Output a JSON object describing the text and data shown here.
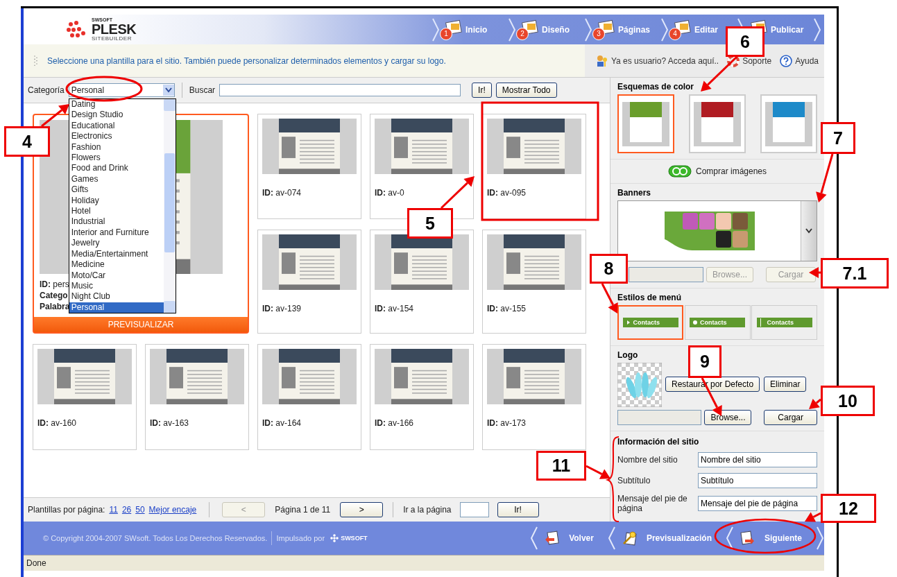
{
  "header": {
    "logo": {
      "maker": "SWSOFT",
      "brand": "PLESK",
      "product": "SITEBUILDER"
    },
    "steps": [
      {
        "number": "1",
        "label": "Inicio"
      },
      {
        "number": "2",
        "label": "Diseño"
      },
      {
        "number": "3",
        "label": "Páginas"
      },
      {
        "number": "4",
        "label": "Editar"
      },
      {
        "label": "Publicar"
      }
    ]
  },
  "info_bar": {
    "message": "Seleccione una plantilla para el sitio. También puede personalizar determinados elementos y cargar su logo.",
    "links": [
      {
        "label": "Ya es usuario? Acceda aquí..",
        "kind": "user"
      },
      {
        "label": "Soporte",
        "kind": "support"
      },
      {
        "label": "Ayuda",
        "kind": "help"
      }
    ]
  },
  "toolbar": {
    "category_label": "Categoría",
    "category_value": "Personal",
    "search_label": "Buscar",
    "buttons": [
      "Ir!",
      "Mostrar Todo"
    ]
  },
  "category_dropdown": {
    "expanded": true,
    "options": [
      {
        "label": "Dating",
        "selected": false
      },
      {
        "label": "Design Studio",
        "selected": false
      },
      {
        "label": "Educational",
        "selected": false
      },
      {
        "label": "Electronics",
        "selected": false
      },
      {
        "label": "Fashion",
        "selected": false
      },
      {
        "label": "Flowers",
        "selected": false
      },
      {
        "label": "Food and Drink",
        "selected": false
      },
      {
        "label": "Games",
        "selected": false
      },
      {
        "label": "Gifts",
        "selected": false
      },
      {
        "label": "Holiday",
        "selected": false
      },
      {
        "label": "Hotel",
        "selected": false
      },
      {
        "label": "Industrial",
        "selected": false
      },
      {
        "label": "Interior and Furniture",
        "selected": false
      },
      {
        "label": "Jewelry",
        "selected": false
      },
      {
        "label": "Media/Entertainment",
        "selected": false
      },
      {
        "label": "Medicine",
        "selected": false
      },
      {
        "label": "Moto/Car",
        "selected": false
      },
      {
        "label": "Music",
        "selected": false
      },
      {
        "label": "Night Club",
        "selected": false
      },
      {
        "label": "Personal",
        "selected": true
      }
    ]
  },
  "templates": [
    {
      "id_label": "ID:",
      "id": "pers",
      "selected": true,
      "details": [
        "Catego",
        "Palabra"
      ],
      "action": "PREVISUALIZAR"
    },
    {
      "id_label": "ID:",
      "id": "av-074",
      "selected": false
    },
    {
      "id_label": "ID:",
      "id": "av-0",
      "selected": false
    },
    {
      "id_label": "ID:",
      "id": "av-095",
      "selected": false
    },
    {
      "id_label": "ID:",
      "id": "av-139",
      "selected": false
    },
    {
      "id_label": "ID:",
      "id": "av-154",
      "selected": false
    },
    {
      "id_label": "ID:",
      "id": "av-155",
      "selected": false
    },
    {
      "id_label": "ID:",
      "id": "av-160",
      "selected": false
    },
    {
      "id_label": "ID:",
      "id": "av-163",
      "selected": false
    },
    {
      "id_label": "ID:",
      "id": "av-164",
      "selected": false
    },
    {
      "id_label": "ID:",
      "id": "av-166",
      "selected": false
    },
    {
      "id_label": "ID:",
      "id": "av-173",
      "selected": false
    }
  ],
  "pagination": {
    "per_page_label": "Plantillas por página:",
    "per_page_links": [
      "11",
      "26",
      "50",
      "Mejor encaje"
    ],
    "prev": {
      "label": "<",
      "disabled": true
    },
    "page_text": "Página 1 de 11",
    "next": {
      "label": ">",
      "disabled": false
    },
    "goto_label": "Ir a la página",
    "goto_button": "Ir!"
  },
  "side_panel": {
    "color_schemes": {
      "title": "Esquemas de color",
      "items": [
        {
          "selected": true,
          "color": "#6a9e2c"
        },
        {
          "selected": false,
          "color": "#b01c22"
        },
        {
          "selected": false,
          "color": "#1d8ac9"
        }
      ]
    },
    "buy_images": "Comprar imágenes",
    "banners": {
      "title": "Banners",
      "browse": {
        "label": "Browse...",
        "disabled": true
      },
      "upload": {
        "label": "Cargar",
        "disabled": true
      }
    },
    "menu_styles": {
      "title": "Estilos de menú",
      "items": [
        {
          "label": "Contacts",
          "kind": "arrow",
          "selected": true
        },
        {
          "label": "Contacts",
          "kind": "dot",
          "selected": false
        },
        {
          "label": "Contacts",
          "kind": "bar",
          "selected": false
        }
      ]
    },
    "logo": {
      "title": "Logo",
      "buttons": [
        "Restaurar por Defecto",
        "Eliminar"
      ],
      "browse": {
        "label": "Browse...",
        "disabled": false
      },
      "upload": {
        "label": "Cargar",
        "disabled": false
      }
    },
    "site_info": {
      "title": "Información del sitio",
      "fields": [
        {
          "label": "Nombre del sitio",
          "value": "Nombre del sitio"
        },
        {
          "label": "Subtítulo",
          "value": "Subtítulo"
        },
        {
          "label": "Mensaje del pie de página",
          "value": "Mensaje del pie de página"
        }
      ]
    }
  },
  "footer": {
    "copyright": "© Copyright 2004-2007 SWsoft. Todos Los Derechos Reservados.",
    "powered_by": "Impulsado por",
    "powered_logo": "SWSOFT",
    "nav": [
      {
        "label": "Volver",
        "kind": "back"
      },
      {
        "label": "Previsualización",
        "kind": "preview"
      },
      {
        "label": "Siguiente",
        "kind": "next"
      }
    ]
  },
  "status_bar": {
    "text": "Done"
  },
  "callouts": [
    {
      "label": "4"
    },
    {
      "label": "5"
    },
    {
      "label": "6"
    },
    {
      "label": "7"
    },
    {
      "label": "7.1"
    },
    {
      "label": "8"
    },
    {
      "label": "9"
    },
    {
      "label": "10"
    },
    {
      "label": "11"
    },
    {
      "label": "12"
    }
  ]
}
